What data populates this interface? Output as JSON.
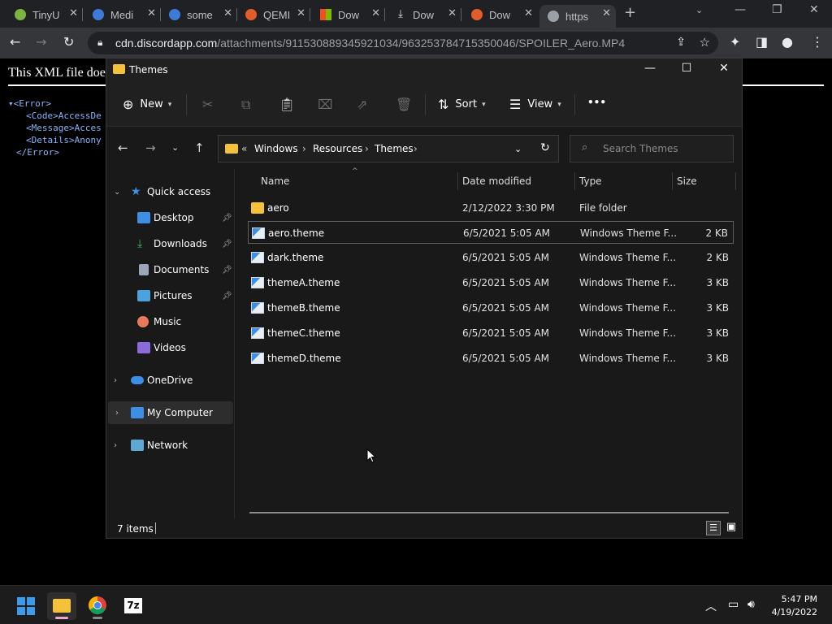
{
  "browser": {
    "tabs": [
      {
        "title": "TinyU",
        "color": "#7cb342"
      },
      {
        "title": "Medi",
        "color": "#3d7bd9"
      },
      {
        "title": "some",
        "color": "#3d7bd9"
      },
      {
        "title": "QEMI",
        "color": "#e35d2a"
      },
      {
        "title": "Dow",
        "color": "#f25022"
      },
      {
        "title": "Dow",
        "color": "#cccccc"
      },
      {
        "title": "Dow",
        "color": "#e35d2a"
      },
      {
        "title": "https",
        "color": "#9aa0a6"
      }
    ],
    "url_host": "cdn.discordapp.com",
    "url_path": "/attachments/911530889345921034/963253784715350046/SPOILER_Aero.MP4"
  },
  "xml_page": {
    "message": "This XML file doe",
    "lines": [
      {
        "text": "<Error>"
      },
      {
        "text": "<Code>AccessDe"
      },
      {
        "text": "<Message>Acces"
      },
      {
        "text": "<Details>Anony"
      },
      {
        "text": "</Error>"
      }
    ]
  },
  "explorer": {
    "title": "Themes",
    "cmd": {
      "new_label": "New",
      "sort_label": "Sort",
      "view_label": "View",
      "more_label": "•••"
    },
    "breadcrumb": [
      "Windows",
      "Resources",
      "Themes"
    ],
    "search_placeholder": "Search Themes",
    "nav": {
      "quick_access": "Quick access",
      "desktop": "Desktop",
      "downloads": "Downloads",
      "documents": "Documents",
      "pictures": "Pictures",
      "music": "Music",
      "videos": "Videos",
      "onedrive": "OneDrive",
      "my_computer": "My Computer",
      "network": "Network"
    },
    "columns": {
      "name": "Name",
      "date": "Date modified",
      "type": "Type",
      "size": "Size"
    },
    "files": [
      {
        "name": "aero",
        "date": "2/12/2022 3:30 PM",
        "type": "File folder",
        "size": ""
      },
      {
        "name": "aero.theme",
        "date": "6/5/2021 5:05 AM",
        "type": "Windows Theme F...",
        "size": "2 KB"
      },
      {
        "name": "dark.theme",
        "date": "6/5/2021 5:05 AM",
        "type": "Windows Theme F...",
        "size": "2 KB"
      },
      {
        "name": "themeA.theme",
        "date": "6/5/2021 5:05 AM",
        "type": "Windows Theme F...",
        "size": "3 KB"
      },
      {
        "name": "themeB.theme",
        "date": "6/5/2021 5:05 AM",
        "type": "Windows Theme F...",
        "size": "3 KB"
      },
      {
        "name": "themeC.theme",
        "date": "6/5/2021 5:05 AM",
        "type": "Windows Theme F...",
        "size": "3 KB"
      },
      {
        "name": "themeD.theme",
        "date": "6/5/2021 5:05 AM",
        "type": "Windows Theme F...",
        "size": "3 KB"
      }
    ],
    "status": "7 items"
  },
  "taskbar": {
    "time": "5:47 PM",
    "date": "4/19/2022",
    "app_7zip_label": "7z"
  },
  "colors": {
    "folder": "#f3c13a",
    "accent_blue": "#3d8ee6"
  }
}
